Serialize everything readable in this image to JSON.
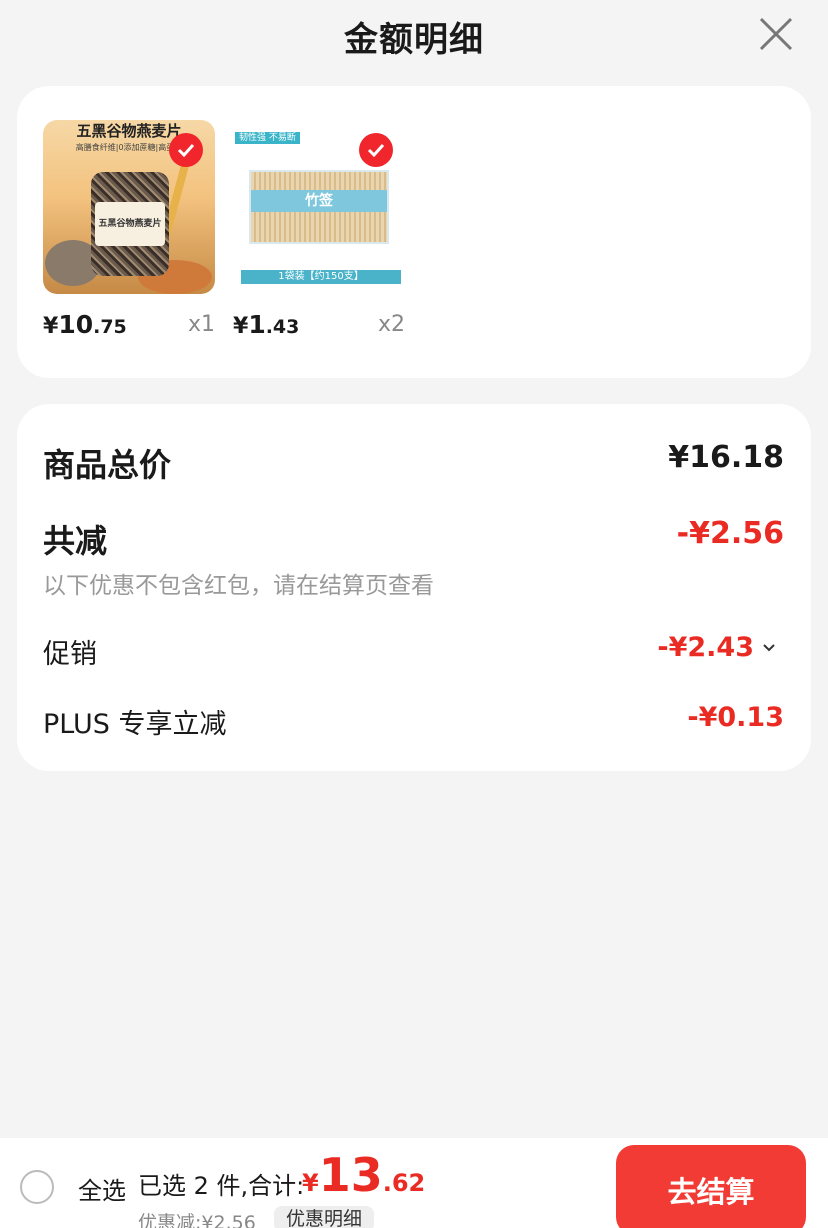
{
  "header": {
    "title": "金额明细"
  },
  "products": [
    {
      "price_sym": "¥",
      "price_int": "10",
      "price_dec": ".75",
      "qty": "x1",
      "thumb_banner": "五黑谷物燕麦片",
      "thumb_sub": "高膳食纤维|0添加蔗糖|高蛋白",
      "thumb_label": "五黑谷物燕麦片"
    },
    {
      "price_sym": "¥",
      "price_int": "1",
      "price_dec": ".43",
      "qty": "x2",
      "thumb_tag": "韧性强 不易断",
      "thumb_band": "竹签",
      "thumb_foot": "1袋装【约150支】"
    }
  ],
  "summary": {
    "total_label": "商品总价",
    "total_value": "¥16.18",
    "reduce_label": "共减",
    "reduce_value": "-¥2.56",
    "note": "以下优惠不包含红包，请在结算页查看",
    "promo_label": "促销",
    "promo_value": "-¥2.43",
    "plus_label": "PLUS 专享立减",
    "plus_value": "-¥0.13"
  },
  "bottom": {
    "select_all": "全选",
    "selected_text": "已选 2 件,合计:",
    "total_sym": "¥",
    "total_int": "13",
    "total_dec": ".62",
    "discount_text": "优惠减:¥2.56",
    "detail_button": "优惠明细",
    "checkout_button": "去结算"
  },
  "colors": {
    "accent": "#ea2b23",
    "checkout_bg": "#f23b34",
    "background": "#f4f4f4"
  }
}
